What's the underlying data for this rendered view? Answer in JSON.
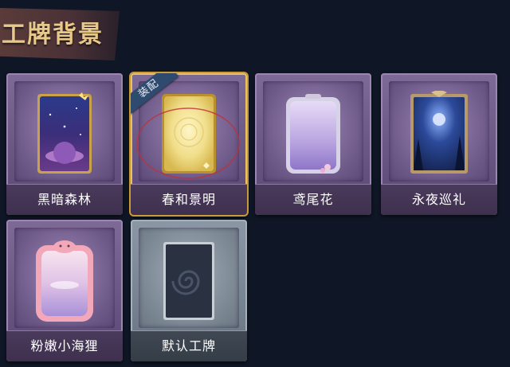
{
  "header": {
    "title": "工牌背景"
  },
  "cards": [
    {
      "label": "黑暗森林",
      "equipped": false,
      "style": "purple"
    },
    {
      "label": "春和景明",
      "equipped": true,
      "style": "purple",
      "badge": "装配"
    },
    {
      "label": "鸢尾花",
      "equipped": false,
      "style": "purple"
    },
    {
      "label": "永夜巡礼",
      "equipped": false,
      "style": "purple"
    },
    {
      "label": "粉嫩小海狸",
      "equipped": false,
      "style": "purple"
    },
    {
      "label": "默认工牌",
      "equipped": false,
      "style": "grey"
    }
  ],
  "colors": {
    "page_bg": "#0f1626",
    "title": "#e8c98a",
    "card_purple": "#6c5884",
    "card_grey": "#75828f",
    "equipped_border": "#e8c262",
    "badge_bg": "#2e4a6e"
  }
}
